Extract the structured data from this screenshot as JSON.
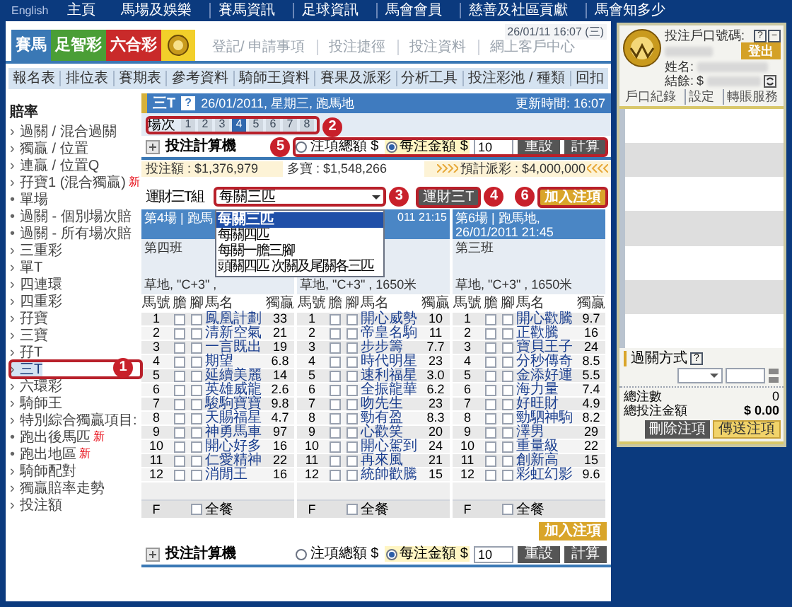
{
  "top_nav": {
    "language": "English",
    "items": [
      "主頁",
      "馬場及娛樂",
      "賽馬資訊",
      "足球資訊",
      "馬會會員",
      "慈善及社區貢獻",
      "馬會知多少"
    ]
  },
  "header": {
    "tabs": [
      {
        "label": "賽馬",
        "color": "#3a78b5"
      },
      {
        "label": "足智彩",
        "color": "#4a9e36"
      },
      {
        "label": "六合彩",
        "color": "#c92a2a"
      }
    ],
    "links": [
      "登記/ 申請事項",
      "投注捷徑",
      "投注資料",
      "網上客戶中心"
    ],
    "datetime": "26/01/11 16:07 (三)"
  },
  "sub_nav": [
    "報名表",
    "排位表",
    "賽期表",
    "參考資料",
    "騎師王資料",
    "賽果及派彩",
    "分析工具",
    "投注彩池 / 種類",
    "回扣"
  ],
  "sidebar": {
    "title": "賠率",
    "items": [
      {
        "bullet": "›",
        "label": "過關 / 混合過關",
        "selected": false
      },
      {
        "bullet": "›",
        "label": "獨贏 / 位置",
        "selected": false
      },
      {
        "bullet": "›",
        "label": "連贏 / 位置Q",
        "selected": false
      },
      {
        "bullet": "›",
        "label": "孖寶1 (混合獨贏)",
        "badge": "新",
        "selected": false
      },
      {
        "bullet": "•",
        "label": "單場",
        "selected": false
      },
      {
        "bullet": "•",
        "label": "過關 - 個別場次賠",
        "selected": false
      },
      {
        "bullet": "•",
        "label": "過關 - 所有場次賠",
        "selected": false
      },
      {
        "bullet": "›",
        "label": "三重彩",
        "selected": false
      },
      {
        "bullet": "›",
        "label": "單T",
        "selected": false
      },
      {
        "bullet": "›",
        "label": "四連環",
        "selected": false
      },
      {
        "bullet": "›",
        "label": "四重彩",
        "selected": false
      },
      {
        "bullet": "›",
        "label": "孖寶",
        "selected": false
      },
      {
        "bullet": "›",
        "label": "三寶",
        "selected": false
      },
      {
        "bullet": "›",
        "label": "孖T",
        "selected": false
      },
      {
        "bullet": "›",
        "label": "三T",
        "selected": true
      },
      {
        "bullet": "›",
        "label": "六環彩",
        "selected": false
      },
      {
        "bullet": "›",
        "label": "騎師王",
        "selected": false
      },
      {
        "bullet": "›",
        "label": "特別綜合獨贏項目:",
        "selected": false
      },
      {
        "bullet": "•",
        "label": "跑出後馬匹",
        "badge": "新",
        "selected": false
      },
      {
        "bullet": "•",
        "label": "跑出地區",
        "badge": "新",
        "selected": false
      },
      {
        "bullet": "›",
        "label": "騎師配對",
        "selected": false
      },
      {
        "bullet": "›",
        "label": "獨贏賠率走勢",
        "selected": false
      },
      {
        "bullet": "›",
        "label": "投注額",
        "selected": false
      }
    ]
  },
  "title_bar": {
    "title": "三T",
    "help": "?",
    "meeting": "26/01/2011, 星期三, 跑馬地",
    "updated": "更新時間: 16:07"
  },
  "race_selector": {
    "label": "場次",
    "races": [
      {
        "label": "1",
        "selected": false
      },
      {
        "label": "2",
        "selected": false
      },
      {
        "label": "3",
        "selected": false
      },
      {
        "label": "4",
        "selected": true
      },
      {
        "label": "5",
        "selected": false
      },
      {
        "label": "6",
        "selected": false
      },
      {
        "label": "7",
        "selected": false
      },
      {
        "label": "8",
        "selected": false
      }
    ]
  },
  "calculator": {
    "title": "投注計算機",
    "options": [
      {
        "label": "注項總額 $",
        "selected": false
      },
      {
        "label": "每注金額 $",
        "selected": true
      }
    ],
    "amount": "10",
    "buttons": [
      "重設",
      "計算"
    ]
  },
  "pools": {
    "turnover": "投注額 : $1,376,979",
    "jackpot": "多寶 : $1,548,266",
    "estimate": "預計派彩 : $4,000,000"
  },
  "combo": {
    "label": "運財三T組",
    "value": "每關三匹",
    "options": [
      {
        "label": "每關三匹",
        "selected": true
      },
      {
        "label": "每關四匹",
        "selected": false
      },
      {
        "label": "每關一膽三腳",
        "selected": false
      },
      {
        "label": "頭關四匹 次關及尾關各三匹",
        "selected": false
      }
    ],
    "button": "運財三T",
    "add_button": "加入注項"
  },
  "races": [
    {
      "columns": [
        "馬號",
        "膽",
        "腳",
        "馬名",
        "獨贏"
      ],
      "title": "第4場 | 跑馬",
      "info": [
        "第四班",
        "草地, \"C+3\" ,"
      ],
      "footer": {
        "field": "F",
        "label": "全餐",
        "checked": false
      },
      "horses": [
        {
          "no": "1",
          "name": "鳳凰計劃",
          "odds": "33",
          "banker": false,
          "leg": false
        },
        {
          "no": "2",
          "name": "清新空氣",
          "odds": "21",
          "banker": false,
          "leg": false
        },
        {
          "no": "3",
          "name": "一言既出",
          "odds": "19",
          "banker": false,
          "leg": false
        },
        {
          "no": "4",
          "name": "期望",
          "odds": "6.8",
          "banker": false,
          "leg": false
        },
        {
          "no": "5",
          "name": "延續美麗",
          "odds": "14",
          "banker": false,
          "leg": false
        },
        {
          "no": "6",
          "name": "英雄威龍",
          "odds": "2.6",
          "banker": false,
          "leg": false
        },
        {
          "no": "7",
          "name": "駿駒寶寶",
          "odds": "9.8",
          "banker": false,
          "leg": false
        },
        {
          "no": "8",
          "name": "天賜福星",
          "odds": "4.7",
          "banker": false,
          "leg": false
        },
        {
          "no": "9",
          "name": "神勇馬車",
          "odds": "97",
          "banker": false,
          "leg": false
        },
        {
          "no": "10",
          "name": "開心好多",
          "odds": "16",
          "banker": false,
          "leg": false
        },
        {
          "no": "11",
          "name": "仁愛精神",
          "odds": "22",
          "banker": false,
          "leg": false
        },
        {
          "no": "12",
          "name": "消閒王",
          "odds": "16",
          "banker": false,
          "leg": false
        }
      ]
    },
    {
      "columns": [
        "馬號",
        "膽",
        "腳",
        "馬名",
        "獨贏"
      ],
      "title": "011 21:15",
      "info": [
        "草地, \"C+3\" , 1650米"
      ],
      "footer": {
        "field": "F",
        "label": "全餐",
        "checked": false
      },
      "horses": [
        {
          "no": "1",
          "name": "開心威勢",
          "odds": "10",
          "banker": false,
          "leg": false
        },
        {
          "no": "2",
          "name": "帝皇名駒",
          "odds": "11",
          "banker": false,
          "leg": false
        },
        {
          "no": "3",
          "name": "步步籌",
          "odds": "7.7",
          "banker": false,
          "leg": false
        },
        {
          "no": "4",
          "name": "時代明星",
          "odds": "23",
          "banker": false,
          "leg": false
        },
        {
          "no": "5",
          "name": "速利福星",
          "odds": "3.0",
          "banker": false,
          "leg": false
        },
        {
          "no": "6",
          "name": "全振龍華",
          "odds": "6.2",
          "banker": false,
          "leg": false
        },
        {
          "no": "7",
          "name": "吻先生",
          "odds": "23",
          "banker": false,
          "leg": false
        },
        {
          "no": "8",
          "name": "勁有盈",
          "odds": "8.3",
          "banker": false,
          "leg": false
        },
        {
          "no": "9",
          "name": "心歡笑",
          "odds": "20",
          "banker": false,
          "leg": false
        },
        {
          "no": "10",
          "name": "開心駕到",
          "odds": "24",
          "banker": false,
          "leg": false
        },
        {
          "no": "11",
          "name": "再來風",
          "odds": "21",
          "banker": false,
          "leg": false
        },
        {
          "no": "12",
          "name": "統帥歡騰",
          "odds": "15",
          "banker": false,
          "leg": false
        }
      ]
    },
    {
      "columns": [
        "馬號",
        "膽",
        "腳",
        "馬名",
        "獨贏"
      ],
      "title": "第6場 | 跑馬地, 26/01/2011 21:45",
      "info": [
        "第三班",
        "草地, \"C+3\" , 1650米"
      ],
      "footer": {
        "field": "F",
        "label": "全餐",
        "checked": false
      },
      "horses": [
        {
          "no": "1",
          "name": "開心歡騰",
          "odds": "9.7",
          "banker": false,
          "leg": false
        },
        {
          "no": "2",
          "name": "正歡騰",
          "odds": "16",
          "banker": false,
          "leg": false
        },
        {
          "no": "3",
          "name": "寶貝王子",
          "odds": "24",
          "banker": false,
          "leg": false
        },
        {
          "no": "4",
          "name": "分秒傳奇",
          "odds": "8.5",
          "banker": false,
          "leg": false
        },
        {
          "no": "5",
          "name": "金添好運",
          "odds": "5.5",
          "banker": false,
          "leg": false
        },
        {
          "no": "6",
          "name": "海力量",
          "odds": "7.4",
          "banker": false,
          "leg": false
        },
        {
          "no": "7",
          "name": "好旺財",
          "odds": "4.9",
          "banker": false,
          "leg": false
        },
        {
          "no": "8",
          "name": "勁駟神駒",
          "odds": "8.2",
          "banker": false,
          "leg": false
        },
        {
          "no": "9",
          "name": "澤男",
          "odds": "29",
          "banker": false,
          "leg": false
        },
        {
          "no": "10",
          "name": "重量級",
          "odds": "22",
          "banker": false,
          "leg": false
        },
        {
          "no": "11",
          "name": "創新高",
          "odds": "15",
          "banker": false,
          "leg": false
        },
        {
          "no": "12",
          "name": "彩虹幻影",
          "odds": "9.6",
          "banker": false,
          "leg": false
        }
      ]
    }
  ],
  "bottom": {
    "add_button": "加入注項",
    "calculator": {
      "title": "投注計算機",
      "options": [
        {
          "label": "注項總額 $",
          "selected": false
        },
        {
          "label": "每注金額 $",
          "selected": true
        }
      ],
      "amount": "10",
      "buttons": [
        "重設",
        "計算"
      ]
    }
  },
  "account_panel": {
    "help": "?",
    "minimize": "−",
    "account_label": "投注戶口號碼:",
    "logout": "登出",
    "name_label": "姓名:",
    "balance_label": "結餘:",
    "currency": "$",
    "links": [
      "戶口紀錄",
      "設定",
      "轉賬服務"
    ],
    "multiple_label": "過關方式",
    "multiple_help": "?",
    "total_bets_label": "總注數",
    "total_bets": "0",
    "total_amount_label": "總投注金額",
    "total_amount": "$ 0.00",
    "buttons": [
      "刪除注項",
      "傳送注項"
    ]
  },
  "callouts": [
    {
      "number": "1"
    },
    {
      "number": "2"
    },
    {
      "number": "3"
    },
    {
      "number": "4"
    },
    {
      "number": "5"
    },
    {
      "number": "6"
    }
  ]
}
